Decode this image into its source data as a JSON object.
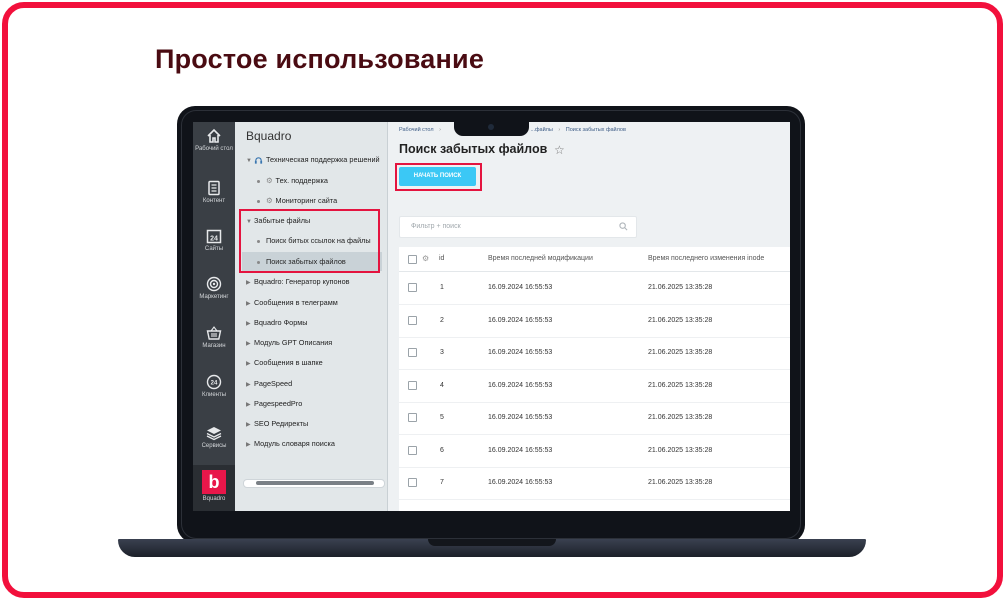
{
  "headline": "Простое использование",
  "rail": {
    "items": [
      {
        "label": "Рабочий стол",
        "icon": "home-icon"
      },
      {
        "label": "Контент",
        "icon": "document-icon"
      },
      {
        "label": "Сайты",
        "icon": "calendar-24-icon"
      },
      {
        "label": "Маркетинг",
        "icon": "target-icon"
      },
      {
        "label": "Магазин",
        "icon": "basket-icon"
      },
      {
        "label": "Клиенты",
        "icon": "clock-24-icon"
      },
      {
        "label": "Сервисы",
        "icon": "layers-icon"
      },
      {
        "label": "Bquadro",
        "icon": "bquadro-logo-icon"
      }
    ]
  },
  "menu": {
    "title": "Bquadro",
    "items": [
      {
        "label": "Техническая поддержка решений"
      },
      {
        "label": "Тех. поддержка"
      },
      {
        "label": "Мониторинг сайта"
      },
      {
        "label": "Забытые файлы"
      },
      {
        "label": "Поиск битых ссылок на файлы"
      },
      {
        "label": "Поиск забытых файлов"
      },
      {
        "label": "Bquadro: Генератор купонов"
      },
      {
        "label": "Сообщения в телеграмм"
      },
      {
        "label": "Bquadro Формы"
      },
      {
        "label": "Модуль GPT Описания"
      },
      {
        "label": "Сообщения в шапке"
      },
      {
        "label": "PageSpeed"
      },
      {
        "label": "PagespeedPro"
      },
      {
        "label": "SEO Редиректы"
      },
      {
        "label": "Модуль словаря поиска"
      }
    ],
    "logo_letter": "b"
  },
  "content": {
    "breadcrumb": [
      "Рабочий стол",
      "...файлы",
      "Поиск забытых файлов"
    ],
    "breadcrumb_sep": "›",
    "page_title": "Поиск забытых файлов",
    "start_button": "НАЧАТЬ ПОИСК",
    "search_placeholder": "Фильтр + поиск",
    "columns": [
      "id",
      "Время последней модификации",
      "Время последнего изменения inode"
    ],
    "rows": [
      {
        "id": "1",
        "modified": "16.09.2024 16:55:53",
        "inode": "21.06.2025 13:35:28"
      },
      {
        "id": "2",
        "modified": "16.09.2024 16:55:53",
        "inode": "21.06.2025 13:35:28"
      },
      {
        "id": "3",
        "modified": "16.09.2024 16:55:53",
        "inode": "21.06.2025 13:35:28"
      },
      {
        "id": "4",
        "modified": "16.09.2024 16:55:53",
        "inode": "21.06.2025 13:35:28"
      },
      {
        "id": "5",
        "modified": "16.09.2024 16:55:53",
        "inode": "21.06.2025 13:35:28"
      },
      {
        "id": "6",
        "modified": "16.09.2024 16:55:53",
        "inode": "21.06.2025 13:35:28"
      },
      {
        "id": "7",
        "modified": "16.09.2024 16:55:53",
        "inode": "21.06.2025 13:35:28"
      }
    ]
  },
  "colors": {
    "frame": "#f2103c",
    "headline": "#4a0b12",
    "highlight_box": "#e4143f",
    "start_button": "#3bc8f5",
    "brand": "#e8174a"
  }
}
